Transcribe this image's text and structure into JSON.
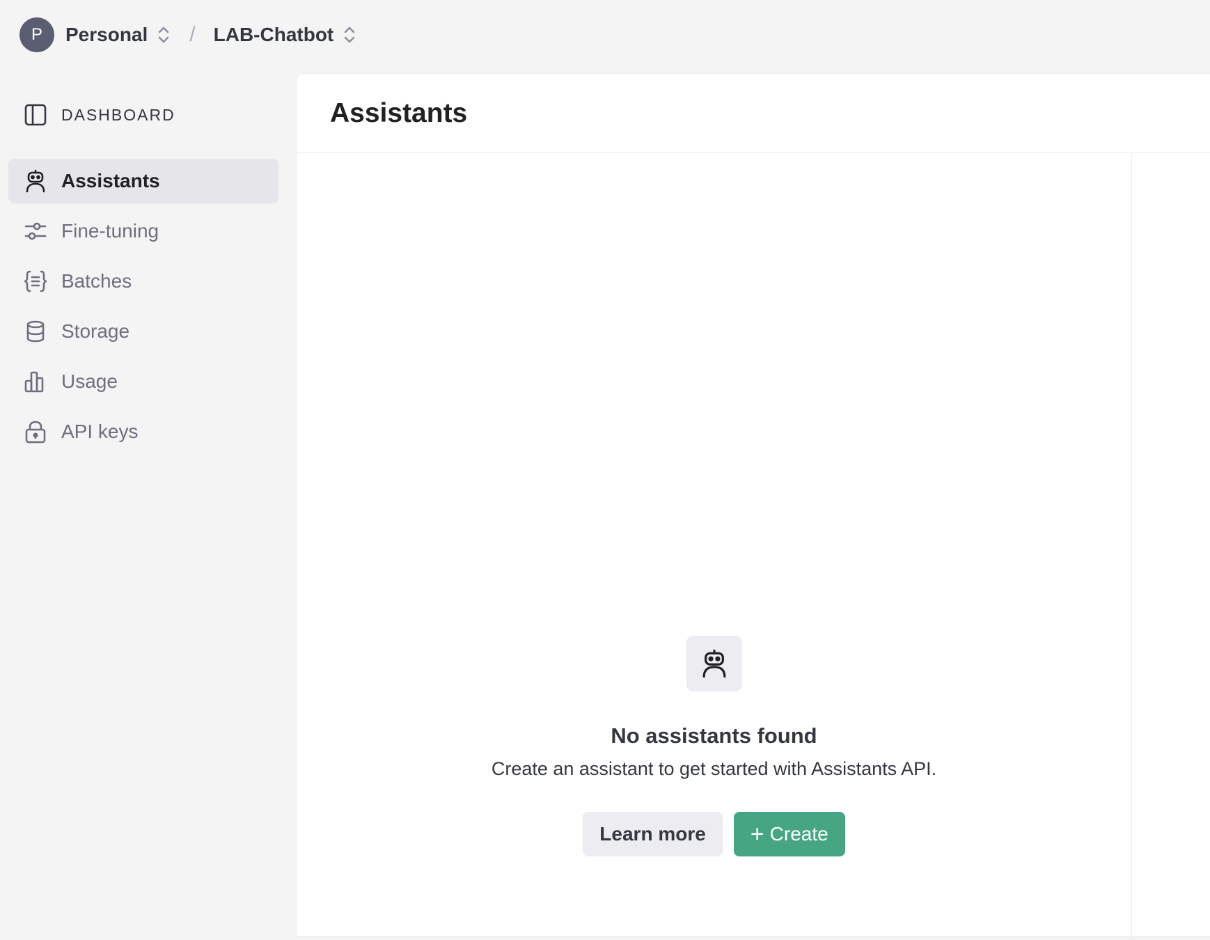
{
  "header": {
    "avatar_initial": "P",
    "org_label": "Personal",
    "separator": "/",
    "project_label": "LAB-Chatbot"
  },
  "sidebar": {
    "section_label": "DASHBOARD",
    "items": [
      {
        "label": "Assistants",
        "icon": "robot-icon",
        "active": true
      },
      {
        "label": "Fine-tuning",
        "icon": "sliders-icon",
        "active": false
      },
      {
        "label": "Batches",
        "icon": "braces-icon",
        "active": false
      },
      {
        "label": "Storage",
        "icon": "database-icon",
        "active": false
      },
      {
        "label": "Usage",
        "icon": "bar-chart-icon",
        "active": false
      },
      {
        "label": "API keys",
        "icon": "lock-icon",
        "active": false
      }
    ]
  },
  "main": {
    "title": "Assistants",
    "empty_state": {
      "icon": "robot-icon",
      "title": "No assistants found",
      "subtitle": "Create an assistant to get started with Assistants API.",
      "learn_more_label": "Learn more",
      "create_label": "Create"
    }
  },
  "colors": {
    "accent_green": "#46a683",
    "sidebar_active_bg": "#e5e5ea",
    "avatar_bg": "#5b5e72"
  }
}
